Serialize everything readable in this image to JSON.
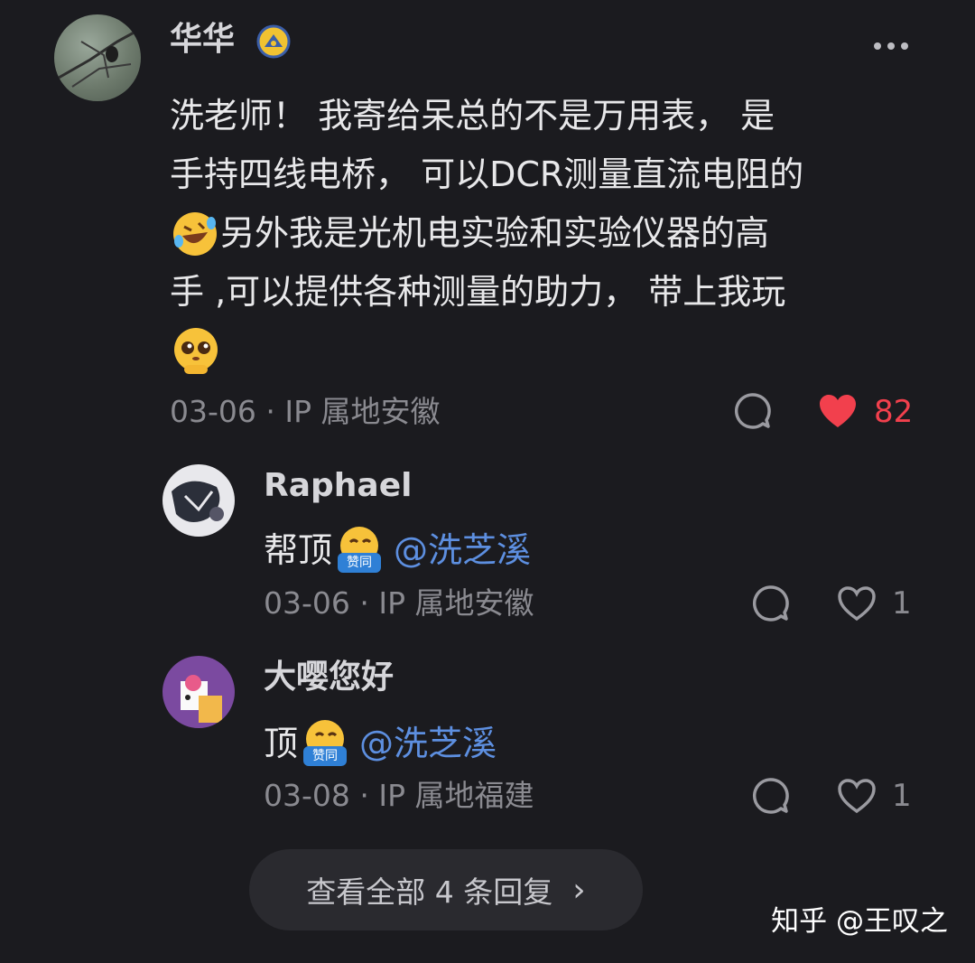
{
  "comment": {
    "author": "华华",
    "text_lines": [
      "洗老师！ 我寄给呆总的不是万用表， 是",
      "手持四线电桥， 可以DCR测量直流电阻的",
      " 另外我是光机电实验和实验仪器的高",
      "手 ,可以提供各种测量的助力， 带上我玩"
    ],
    "date": "03-06",
    "location": "IP 属地安徽",
    "likes": "82",
    "icons": {
      "badge": "verified-badge-icon",
      "more": "more-icon",
      "comment": "comment-icon",
      "like": "heart-filled-icon",
      "emoji1": "rofl-emoji",
      "emoji2": "pleading-emoji"
    },
    "like_color": "#f2404d"
  },
  "replies": [
    {
      "author": "Raphael",
      "text": "帮顶",
      "sticker": "赞同",
      "mention": "@洗芝溪",
      "date": "03-06",
      "location": "IP 属地安徽",
      "likes": "1"
    },
    {
      "author": "大嘤您好",
      "text": "顶",
      "sticker": "赞同",
      "mention": "@洗芝溪",
      "date": "03-08",
      "location": "IP 属地福建",
      "likes": "1"
    }
  ],
  "view_all": {
    "label": "查看全部 4 条回复",
    "chevron": "›"
  },
  "watermark": "知乎 @王叹之",
  "mention_color": "#5d8fe0"
}
